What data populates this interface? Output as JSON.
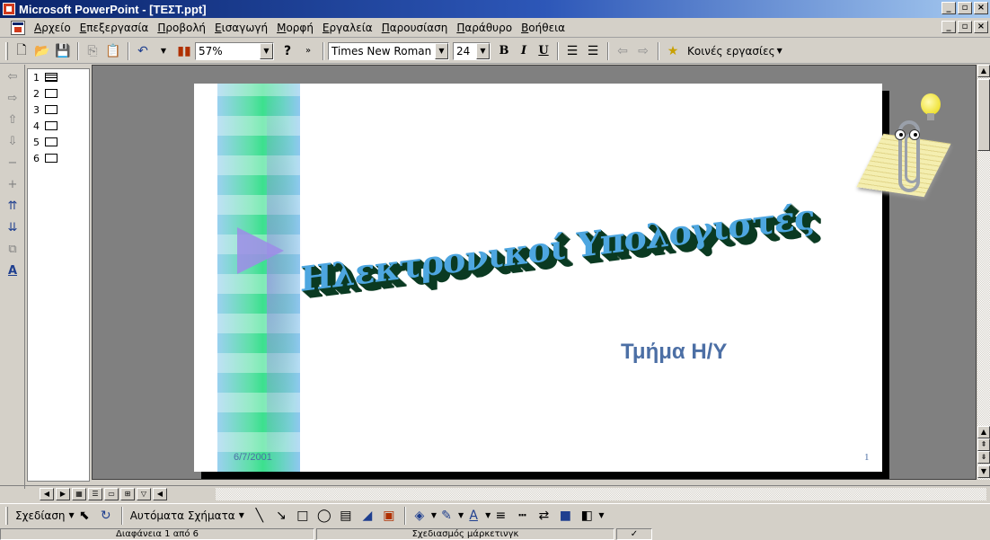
{
  "window": {
    "title": "Microsoft PowerPoint - [ΤΕΣΤ.ppt]",
    "controls": [
      "_",
      "▫",
      "×"
    ]
  },
  "menu": {
    "items": [
      "Αρχείο",
      "Επεξεργασία",
      "Προβολή",
      "Εισαγωγή",
      "Μορφή",
      "Εργαλεία",
      "Παρουσίαση",
      "Παράθυρο",
      "Βοήθεια"
    ]
  },
  "toolbar": {
    "zoom": "57%",
    "font_name": "Times New Roman",
    "font_size": "24",
    "bold": "B",
    "italic": "I",
    "underline": "U",
    "common_tasks": "Κοινές εργασίες"
  },
  "outline": {
    "slides": [
      "1",
      "2",
      "3",
      "4",
      "5",
      "6"
    ]
  },
  "slide": {
    "wordart_title": "Ηλεκτρονικοί Υπολογιστές",
    "subtitle": "Τμήμα Η/Υ",
    "date": "6/7/2001",
    "number": "1",
    "colors": {
      "subtitle": "#4c6fa5",
      "wordart_face": "#4da6e0",
      "wordart_depth": "#0b3a22"
    }
  },
  "drawbar": {
    "draw_menu": "Σχεδίαση",
    "autoshapes": "Αυτόματα Σχήματα"
  },
  "status": {
    "slide_position": "Διαφάνεια 1 από 6",
    "design": "Σχεδιασμός μάρκετινγκ"
  }
}
